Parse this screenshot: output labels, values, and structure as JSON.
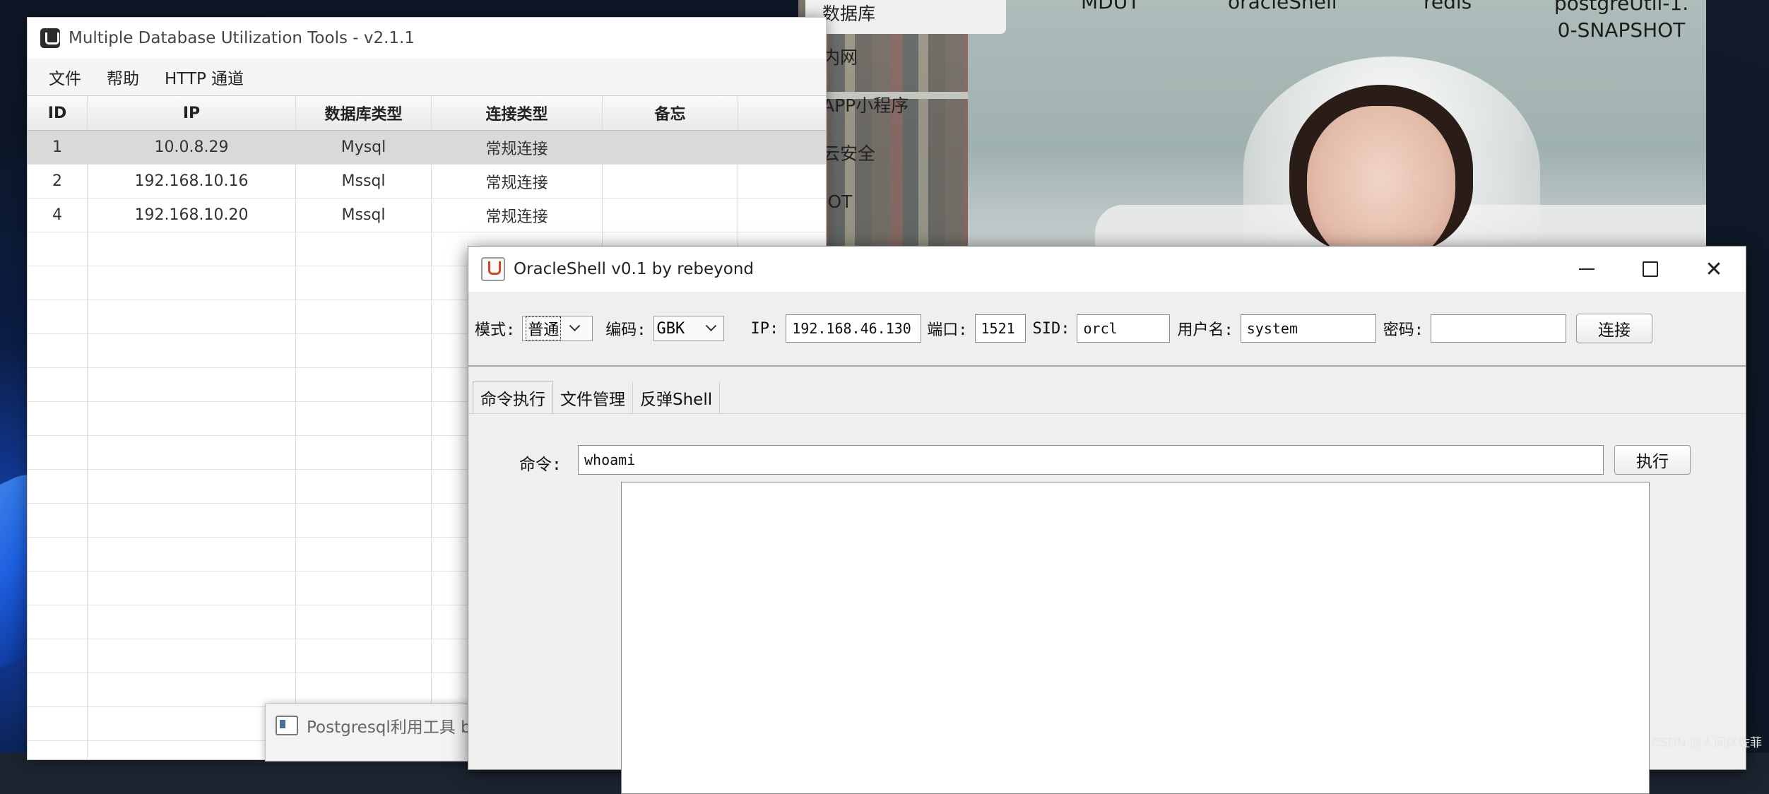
{
  "background_app": {
    "menu": [
      "数据库",
      "内网",
      "APP小程序",
      "云安全",
      "IOT"
    ],
    "columns": [
      "MDUT",
      "oracleShell",
      "redis"
    ],
    "snapshot_text": [
      "postgreUtil-1.",
      "0-SNAPSHOT"
    ]
  },
  "mdut": {
    "title": "Multiple Database Utilization Tools - v2.1.1",
    "menu": [
      "文件",
      "帮助",
      "HTTP 通道"
    ],
    "table": {
      "headers": [
        "ID",
        "IP",
        "数据库类型",
        "连接类型",
        "备忘"
      ],
      "rows": [
        [
          "1",
          "10.0.8.29",
          "Mysql",
          "常规连接",
          ""
        ],
        [
          "2",
          "192.168.10.16",
          "Mssql",
          "常规连接",
          ""
        ],
        [
          "4",
          "192.168.10.20",
          "Mssql",
          "常规连接",
          ""
        ]
      ],
      "selected_row": 0
    }
  },
  "postgres_window": {
    "title": "Postgresql利用工具 b"
  },
  "oracle": {
    "title": "OracleShell v0.1  by rebeyond",
    "labels": {
      "mode": "模式:",
      "encoding": "编码:",
      "ip": "IP:",
      "port": "端口:",
      "sid": "SID:",
      "user": "用户名:",
      "password": "密码:",
      "command": "命令:"
    },
    "mode_value": "普通",
    "encoding_value": "GBK",
    "ip_value": "192.168.46.130",
    "port_value": "1521",
    "sid_value": "orcl",
    "user_value": "system",
    "password_value": "",
    "connect_label": "连接",
    "tabs": [
      "命令执行",
      "文件管理",
      "反弹Shell"
    ],
    "active_tab": 0,
    "command_value": "whoami",
    "exec_label": "执行",
    "close_glyph": "✕"
  },
  "watermark": "CSDN @人间体佐菲"
}
